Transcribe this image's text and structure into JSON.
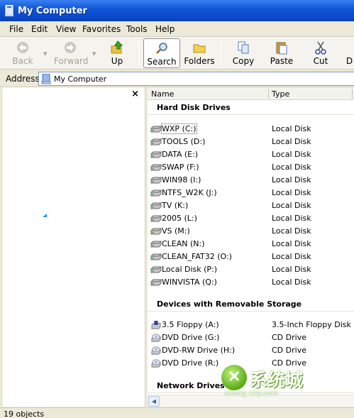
{
  "window": {
    "title": "My Computer"
  },
  "menu": [
    "File",
    "Edit",
    "View",
    "Favorites",
    "Tools",
    "Help"
  ],
  "toolbar": {
    "back": "Back",
    "forward": "Forward",
    "up": "Up",
    "search": "Search",
    "folders": "Folders",
    "copy": "Copy",
    "paste": "Paste",
    "cut": "Cut",
    "overflow": "D"
  },
  "address": {
    "label": "Address",
    "value": "My Computer"
  },
  "left_pane": {
    "close": "×"
  },
  "columns": {
    "name": "Name",
    "type": "Type"
  },
  "groups": {
    "hdd": "Hard Disk Drives",
    "removable": "Devices with Removable Storage",
    "network": "Network Drives"
  },
  "hdd": [
    {
      "name": "WXP (C:)",
      "type": "Local Disk"
    },
    {
      "name": "TOOLS (D:)",
      "type": "Local Disk"
    },
    {
      "name": "DATA (E:)",
      "type": "Local Disk"
    },
    {
      "name": "SWAP (F:)",
      "type": "Local Disk"
    },
    {
      "name": "WIN98 (I:)",
      "type": "Local Disk"
    },
    {
      "name": "NTFS_W2K (J:)",
      "type": "Local Disk"
    },
    {
      "name": "TV (K:)",
      "type": "Local Disk"
    },
    {
      "name": "2005 (L:)",
      "type": "Local Disk"
    },
    {
      "name": "VS (M:)",
      "type": "Local Disk"
    },
    {
      "name": "CLEAN (N:)",
      "type": "Local Disk"
    },
    {
      "name": "CLEAN_FAT32 (O:)",
      "type": "Local Disk"
    },
    {
      "name": "Local Disk (P:)",
      "type": "Local Disk"
    },
    {
      "name": "WINVISTA (Q:)",
      "type": "Local Disk"
    }
  ],
  "removable": [
    {
      "name": "3.5 Floppy (A:)",
      "type": "3.5-Inch Floppy Disk",
      "icon": "floppy-icon"
    },
    {
      "name": "DVD Drive (G:)",
      "type": "CD Drive",
      "icon": "cd-drive-icon"
    },
    {
      "name": "DVD-RW Drive (H:)",
      "type": "CD Drive",
      "icon": "cd-drive-icon"
    },
    {
      "name": "DVD Drive (R:)",
      "type": "CD Drive",
      "icon": "cd-drive-icon"
    }
  ],
  "status": {
    "text": "19 objects"
  },
  "watermark": {
    "cn": "系统城",
    "en": "xitong city.com"
  },
  "colors": {
    "titlebar": "#0a48c8",
    "accent": "#1d9ae0"
  }
}
